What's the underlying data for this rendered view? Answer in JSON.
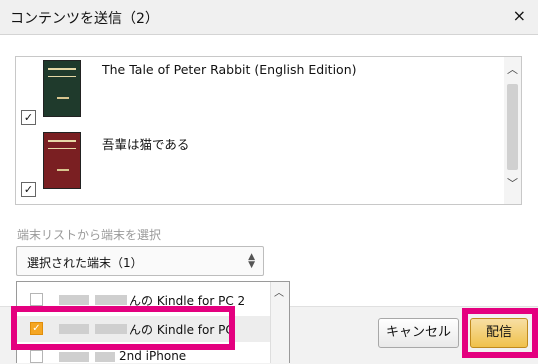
{
  "dialog": {
    "title": "コンテンツを送信（2）",
    "close_glyph": "×"
  },
  "contents": [
    {
      "title": "The Tale of Peter Rabbit (English Edition)",
      "checked": true,
      "cover_color": "#1f3a2c"
    },
    {
      "title": "吾輩は猫である",
      "checked": true,
      "cover_color": "#7a1f22"
    }
  ],
  "scroll_glyphs": {
    "up": "︿",
    "down": "﹀"
  },
  "device_section": {
    "label": "端末リストから端末を選択",
    "selected_value": "選択された端末（1）",
    "caret_up": "▲",
    "caret_down": "▼"
  },
  "device_list": [
    {
      "name": "んの Kindle for PC 2",
      "checked": false
    },
    {
      "name": "んの Kindle for PC",
      "checked": true
    },
    {
      "name": "2nd iPhone",
      "checked": false
    }
  ],
  "buttons": {
    "cancel": "キャンセル",
    "send": "配信"
  },
  "colors": {
    "highlight": "#e4007f",
    "send_button": "#f0c14b",
    "checkbox_checked": "#f5a623"
  }
}
